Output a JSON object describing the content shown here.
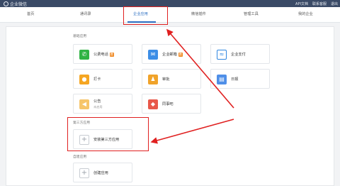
{
  "topbar": {
    "brand": "企业微信",
    "links": [
      "API文档",
      "联系客服",
      "退出"
    ]
  },
  "nav": {
    "items": [
      "首页",
      "通讯录",
      "企业应用",
      "微信插件",
      "管理工具",
      "我的企业"
    ],
    "active": "企业应用"
  },
  "sections": {
    "basic": "基础应用",
    "third_party": "第三方应用",
    "custom": "自建应用"
  },
  "apps": {
    "phone": {
      "label": "公费电话",
      "badge": "费",
      "icon": "phone-icon"
    },
    "mail": {
      "label": "企业邮箱",
      "badge": "费",
      "icon": "mail-icon"
    },
    "pay": {
      "label": "企业支付",
      "icon": "chat-pay-icon"
    },
    "checkin": {
      "label": "打卡",
      "icon": "location-pin-icon"
    },
    "approval": {
      "label": "审批",
      "icon": "stamp-icon"
    },
    "report": {
      "label": "日报",
      "icon": "report-icon"
    },
    "notice": {
      "label": "公告",
      "sub": "未启用",
      "icon": "megaphone-icon"
    },
    "colleague": {
      "label": "同事吧",
      "icon": "diamond-icon"
    },
    "install_third": {
      "label": "安装第三方应用",
      "icon": "plus-icon"
    },
    "create_custom": {
      "label": "创建应用",
      "icon": "plus-icon"
    }
  },
  "colors": {
    "topbar": "#3a4a66",
    "accent": "#2d6fc2",
    "annotation": "#e02020"
  }
}
